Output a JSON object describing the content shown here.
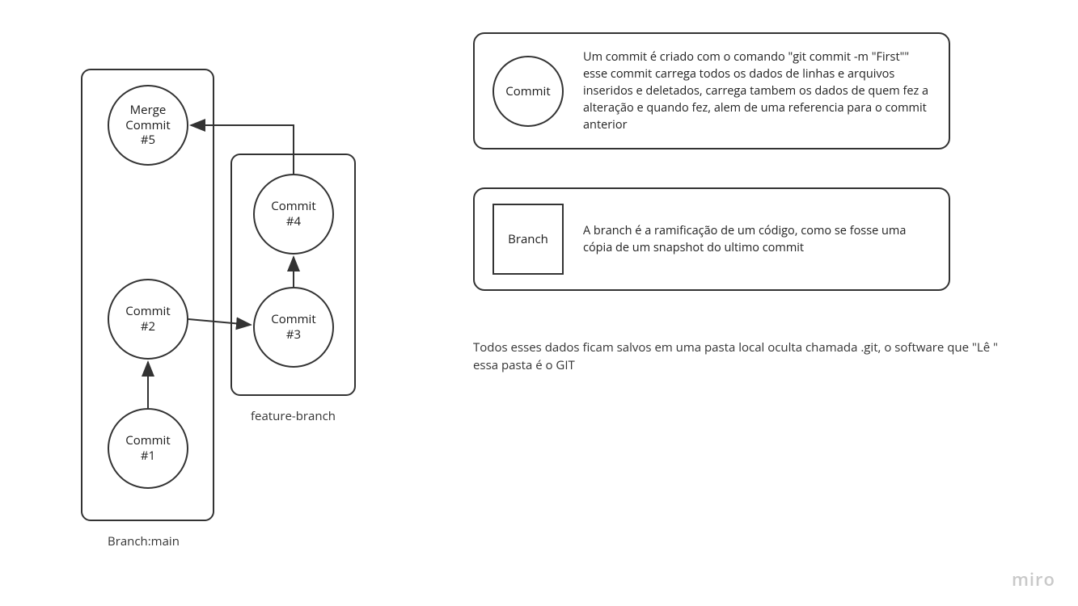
{
  "diagram": {
    "branch_main_label": "Branch:main",
    "branch_feature_label": "feature-branch",
    "commits": {
      "c1": "Commit\n#1",
      "c2": "Commit\n#2",
      "c3": "Commit\n#3",
      "c4": "Commit\n#4",
      "c5": "Merge\nCommit\n#5"
    }
  },
  "legend": {
    "commit_title": "Commit",
    "commit_text": "Um commit é criado com o comando \"git commit -m \"First\"\" esse commit carrega todos os dados de linhas e arquivos inseridos e deletados, carrega tambem os dados de quem fez a alteração e quando fez, alem de uma referencia para o commit anterior",
    "branch_title": "Branch",
    "branch_text": "A branch é a ramificação de um código, como se fosse uma cópia de um snapshot do ultimo commit"
  },
  "note_text": "Todos esses dados ficam salvos em uma pasta local oculta chamada .git, o software que \"Lê \" essa pasta é o GIT",
  "watermark": "miro"
}
